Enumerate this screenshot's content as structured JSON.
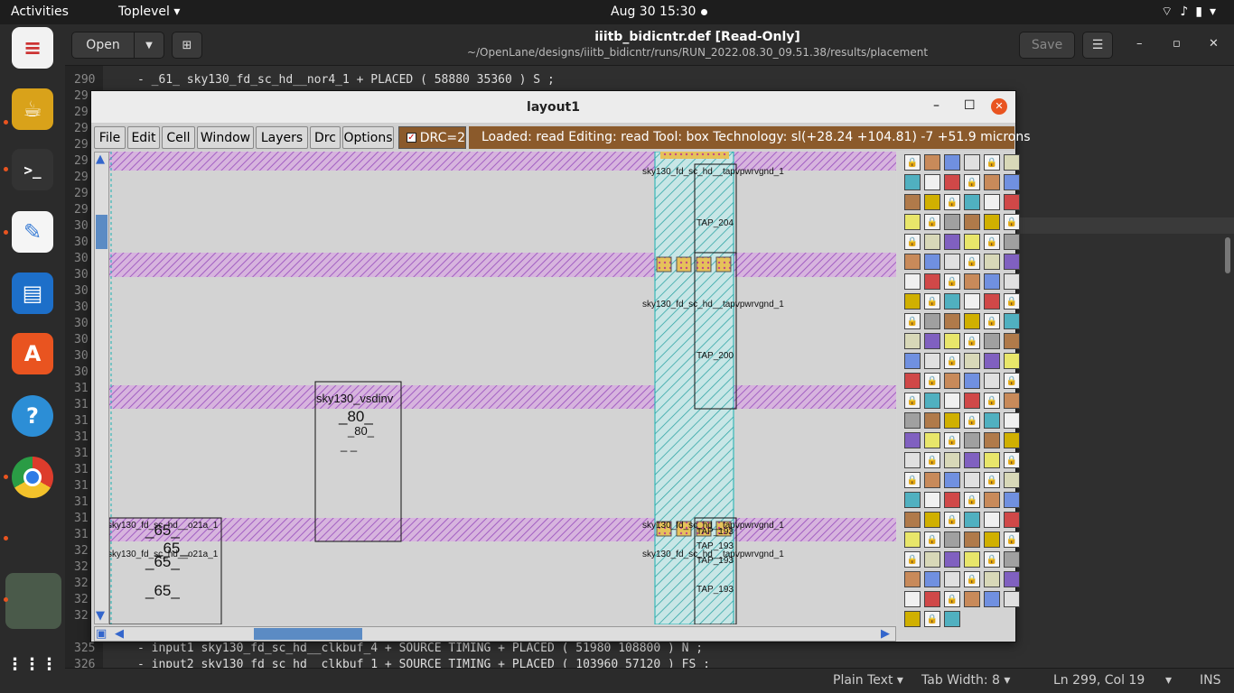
{
  "topbar": {
    "activities": "Activities",
    "app_menu": "Toplevel ▾",
    "clock": "Aug 30  15:30",
    "tray": "⌔♪▮▾"
  },
  "dock": {
    "items": [
      {
        "name": "document-viewer",
        "glyph": "≡",
        "color": "#f3f3f3"
      },
      {
        "name": "gimp",
        "glyph": "☕",
        "color": "#e6b422"
      },
      {
        "name": "terminal",
        "glyph": ">_",
        "color": "#333333"
      },
      {
        "name": "text-editor",
        "glyph": "✎",
        "color": "#3d7fd6"
      },
      {
        "name": "impress",
        "glyph": "▤",
        "color": "#1d6fc9"
      },
      {
        "name": "software",
        "glyph": "A",
        "color": "#e95420"
      },
      {
        "name": "help",
        "glyph": "?",
        "color": "#2c8ed6"
      },
      {
        "name": "chrome",
        "glyph": "◉",
        "color": "#dd3c2c"
      },
      {
        "name": "image",
        "glyph": "",
        "color": "#4a5a4a"
      }
    ],
    "show_apps_glyph": "⋮⋮⋮"
  },
  "gedit": {
    "open_label": "Open",
    "title": "iiitb_bidicntr.def [Read-Only]",
    "subtitle": "~/OpenLane/designs/iiitb_bidicntr/runs/RUN_2022.08.30_09.51.38/results/placement",
    "save_label": "Save",
    "lines": [
      {
        "num": "290",
        "text": "- _61_ sky130_fd_sc_hd__nor4_1 + PLACED ( 58880 35360 ) S ;"
      },
      {
        "num": "29",
        "text": ""
      },
      {
        "num": "29",
        "text": ""
      },
      {
        "num": "29",
        "text": ""
      },
      {
        "num": "29",
        "text": ""
      },
      {
        "num": "29",
        "text": ""
      },
      {
        "num": "29",
        "text": ""
      },
      {
        "num": "29",
        "text": ""
      },
      {
        "num": "29",
        "text": ""
      },
      {
        "num": "30",
        "text": ""
      },
      {
        "num": "30",
        "text": ""
      },
      {
        "num": "30",
        "text": ""
      },
      {
        "num": "30",
        "text": ""
      },
      {
        "num": "30",
        "text": ""
      },
      {
        "num": "30",
        "text": ""
      },
      {
        "num": "30",
        "text": ""
      },
      {
        "num": "30",
        "text": ""
      },
      {
        "num": "30",
        "text": ""
      },
      {
        "num": "30",
        "text": ""
      },
      {
        "num": "31",
        "text": ""
      },
      {
        "num": "31",
        "text": ""
      },
      {
        "num": "31",
        "text": ""
      },
      {
        "num": "31",
        "text": ""
      },
      {
        "num": "31",
        "text": ""
      },
      {
        "num": "31",
        "text": ""
      },
      {
        "num": "31",
        "text": ""
      },
      {
        "num": "31",
        "text": ""
      },
      {
        "num": "31",
        "text": ""
      },
      {
        "num": "31",
        "text": ""
      },
      {
        "num": "32",
        "text": ""
      },
      {
        "num": "32",
        "text": ""
      },
      {
        "num": "32",
        "text": ""
      },
      {
        "num": "32",
        "text": ""
      },
      {
        "num": "32",
        "text": ""
      },
      {
        "num": "325",
        "text": "- input1 sky130_fd_sc_hd__clkbuf_4 + SOURCE TIMING + PLACED ( 51980 108800 ) N ;"
      },
      {
        "num": "326",
        "text": "- input2 sky130_fd_sc_hd__clkbuf_1 + SOURCE TIMING + PLACED ( 103960 57120 ) FS ;"
      }
    ],
    "status": {
      "language": "Plain Text ▾",
      "tab_width": "Tab Width: 8 ▾",
      "position": "Ln 299, Col 19",
      "position_arrow": "▾",
      "mode": "INS"
    }
  },
  "magic": {
    "title": "layout1",
    "menus": [
      "File",
      "Edit",
      "Cell",
      "Window",
      "Layers",
      "Drc",
      "Options"
    ],
    "drc_label": "DRC=2",
    "status_loaded": "Loaded: read  Editing: read  Tool: box   Technology: sl",
    "status_coords": "(+28.24 +104.81) -7 +51.9 microns",
    "cell_labels": {
      "tap1": "sky130_fd_sc_hd__tapvpwrvgnd_1",
      "tap204": "TAP_204",
      "tap200": "TAP_200",
      "vsdinv": "sky130_vsdinv",
      "inst80": "_80_",
      "inst80b": "_80_",
      "inst80c": "_   _",
      "o21a1": "sky130_fd_sc_hd__o21a_1",
      "o21a2": "sky130_fd_sc_hd__o21a_1",
      "inst65a": "_65_",
      "inst65b": "_65_",
      "inst65c": "_65_",
      "inst65d": "_65_",
      "tap193a": "TAP_193",
      "tap193b": "TAP_193",
      "tap193c": "TAP_193",
      "tap193d": "TAP_193"
    }
  }
}
